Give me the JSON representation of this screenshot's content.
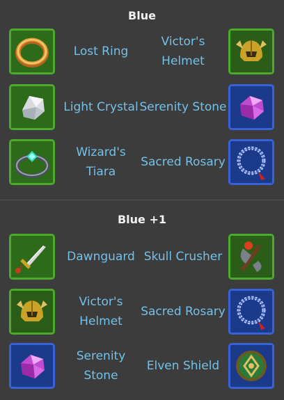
{
  "sections": [
    {
      "title": "Blue",
      "rows": [
        {
          "left": {
            "name": "Lost Ring",
            "icon": "ring-icon",
            "frame": "green"
          },
          "right": {
            "name": "Victor's Helmet",
            "icon": "helmet-icon",
            "frame": "green"
          }
        },
        {
          "left": {
            "name": "Light Crystal",
            "icon": "crystal-icon",
            "frame": "green"
          },
          "right": {
            "name": "Serenity Stone",
            "icon": "gem-icon",
            "frame": "blue"
          }
        },
        {
          "left": {
            "name": "Wizard's Tiara",
            "icon": "tiara-icon",
            "frame": "green"
          },
          "right": {
            "name": "Sacred Rosary",
            "icon": "rosary-icon",
            "frame": "blue"
          }
        }
      ]
    },
    {
      "title": "Blue +1",
      "rows": [
        {
          "left": {
            "name": "Dawnguard",
            "icon": "sword-icon",
            "frame": "green"
          },
          "right": {
            "name": "Skull Crusher",
            "icon": "axe-icon",
            "frame": "green"
          }
        },
        {
          "left": {
            "name": "Victor's Helmet",
            "icon": "helmet-icon",
            "frame": "green"
          },
          "right": {
            "name": "Sacred Rosary",
            "icon": "rosary-icon",
            "frame": "blue"
          }
        },
        {
          "left": {
            "name": "Serenity Stone",
            "icon": "gem-icon",
            "frame": "blue"
          },
          "right": {
            "name": "Elven Shield",
            "icon": "shield-icon",
            "frame": "blue"
          }
        }
      ]
    }
  ]
}
